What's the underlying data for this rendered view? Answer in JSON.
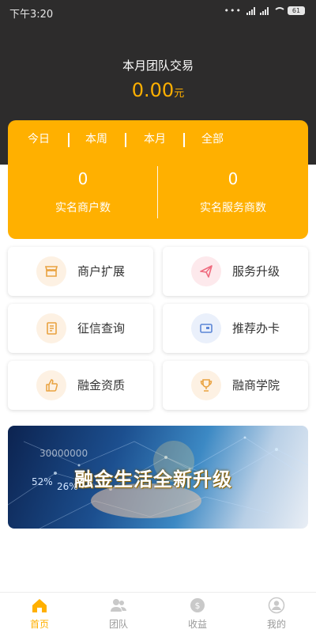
{
  "status_bar": {
    "time": "下午3:20",
    "battery": "61"
  },
  "header": {
    "title": "本月团队交易",
    "amount": "0.00",
    "unit": "元"
  },
  "stats": {
    "tabs": [
      {
        "label": "今日"
      },
      {
        "label": "本周"
      },
      {
        "label": "本月"
      },
      {
        "label": "全部"
      }
    ],
    "merchants": {
      "value": "0",
      "label": "实名商户数"
    },
    "service_providers": {
      "value": "0",
      "label": "实名服务商数"
    }
  },
  "menu": [
    {
      "label": "商户扩展",
      "icon": "store-icon"
    },
    {
      "label": "服务升级",
      "icon": "paper-plane-icon"
    },
    {
      "label": "征信查询",
      "icon": "document-icon"
    },
    {
      "label": "推荐办卡",
      "icon": "card-icon"
    },
    {
      "label": "融金资质",
      "icon": "thumbs-up-icon"
    },
    {
      "label": "融商学院",
      "icon": "trophy-icon"
    }
  ],
  "banner": {
    "text": "融金生活全新升级",
    "pct_a": "52%",
    "pct_b": "26%",
    "num": "30000000"
  },
  "bottom_nav": [
    {
      "label": "首页",
      "icon": "home-icon",
      "active": true
    },
    {
      "label": "团队",
      "icon": "team-icon",
      "active": false
    },
    {
      "label": "收益",
      "icon": "dollar-coin-icon",
      "active": false
    },
    {
      "label": "我的",
      "icon": "user-icon",
      "active": false
    }
  ],
  "colors": {
    "accent": "#ffb000",
    "header_bg": "#2d2c2c"
  }
}
